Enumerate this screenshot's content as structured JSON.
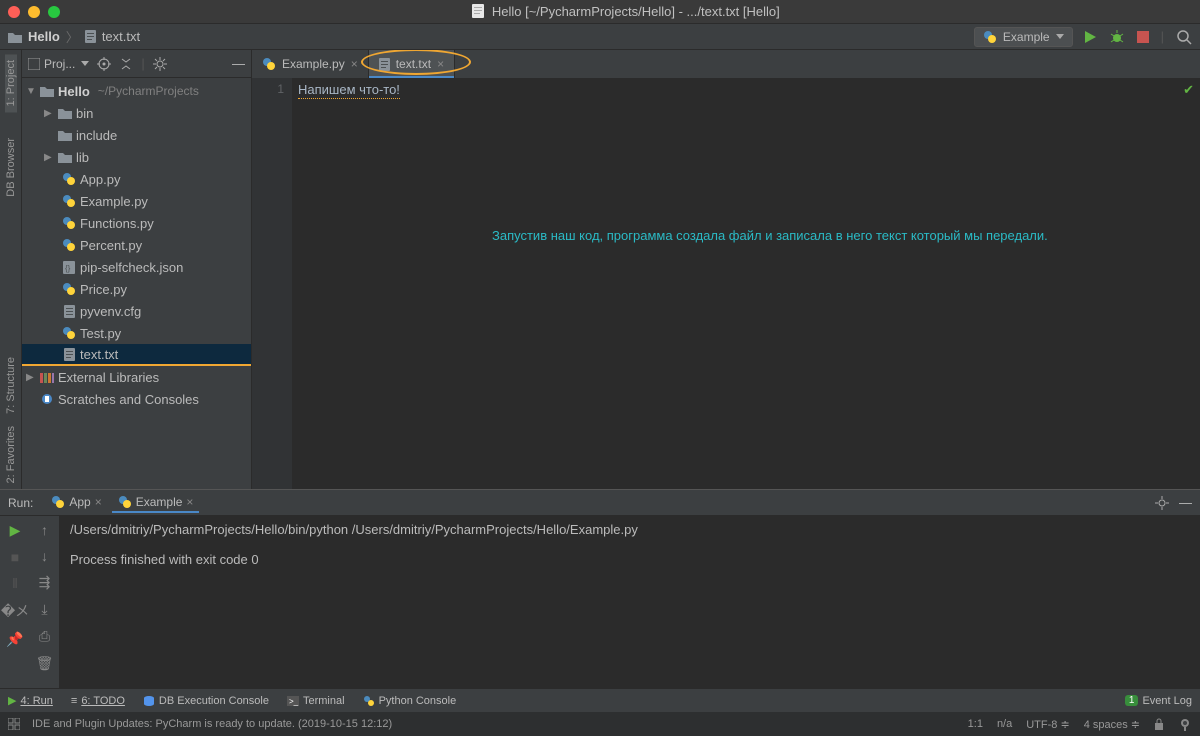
{
  "titlebar": {
    "title": "Hello [~/PycharmProjects/Hello] - .../text.txt [Hello]"
  },
  "breadcrumb": {
    "project": "Hello",
    "file": "text.txt"
  },
  "run_config": {
    "label": "Example"
  },
  "project_panel": {
    "title": "Proj..."
  },
  "tree": {
    "root": {
      "name": "Hello",
      "path": "~/PycharmProjects"
    },
    "items": [
      {
        "name": "bin",
        "type": "folder",
        "expandable": true
      },
      {
        "name": "include",
        "type": "folder",
        "expandable": false
      },
      {
        "name": "lib",
        "type": "folder",
        "expandable": true
      },
      {
        "name": "App.py",
        "type": "py"
      },
      {
        "name": "Example.py",
        "type": "py"
      },
      {
        "name": "Functions.py",
        "type": "py"
      },
      {
        "name": "Percent.py",
        "type": "py"
      },
      {
        "name": "pip-selfcheck.json",
        "type": "json"
      },
      {
        "name": "Price.py",
        "type": "py"
      },
      {
        "name": "pyvenv.cfg",
        "type": "cfg"
      },
      {
        "name": "Test.py",
        "type": "py"
      },
      {
        "name": "text.txt",
        "type": "txt",
        "selected": true
      }
    ],
    "external": "External Libraries",
    "scratches": "Scratches and Consoles"
  },
  "tabs": [
    {
      "label": "Example.py",
      "type": "py",
      "active": false
    },
    {
      "label": "text.txt",
      "type": "txt",
      "active": true,
      "highlighted": true
    }
  ],
  "editor": {
    "line_numbers": [
      "1"
    ],
    "content": "Напишем что-то!",
    "annotation": "Запустив наш код, программа создала файл и записала в него текст который мы передали."
  },
  "run_panel": {
    "title": "Run:",
    "tabs": [
      {
        "label": "App",
        "active": false
      },
      {
        "label": "Example",
        "active": true
      }
    ],
    "output_line1": "/Users/dmitriy/PycharmProjects/Hello/bin/python /Users/dmitriy/PycharmProjects/Hello/Example.py",
    "output_line2": "Process finished with exit code 0"
  },
  "left_rail": {
    "project": "1: Project",
    "db": "DB Browser",
    "structure": "7: Structure",
    "favorites": "2: Favorites"
  },
  "status_tools": {
    "run": "4: Run",
    "todo": "6: TODO",
    "db": "DB Execution Console",
    "terminal": "Terminal",
    "pyconsole": "Python Console",
    "eventlog": "Event Log"
  },
  "statusbar": {
    "message": "IDE and Plugin Updates: PyCharm is ready to update. (2019-10-15 12:12)",
    "pos": "1:1",
    "branch": "n/a",
    "encoding": "UTF-8",
    "indent": "4 spaces"
  }
}
